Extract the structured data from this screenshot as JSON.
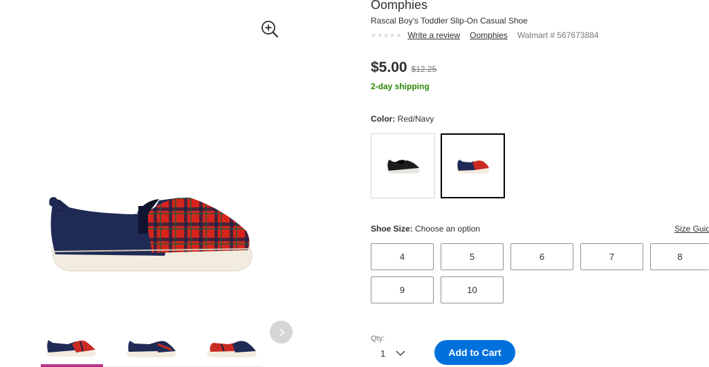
{
  "product": {
    "brand": "Oomphies",
    "name": "Rascal Boy's Toddler Slip-On Casual Shoe",
    "stars": "★★★★★",
    "write_review": "Write a review",
    "brand_link": "Oomphies",
    "walmart_number": "Walmart # 567673884"
  },
  "pricing": {
    "price": "$5.00",
    "was_price": "$12.25",
    "shipping": "2-day shipping"
  },
  "color": {
    "label": "Color:",
    "value": "Red/Navy",
    "options": [
      "Black",
      "Red/Navy"
    ],
    "selected_index": 1
  },
  "size": {
    "label": "Shoe Size:",
    "placeholder": "Choose an option",
    "guide": "Size Guid",
    "options": [
      "4",
      "5",
      "6",
      "7",
      "8",
      "9",
      "10"
    ]
  },
  "purchase": {
    "qty_label": "Qty:",
    "qty_value": "1",
    "add_to_cart": "Add to Cart"
  },
  "gallery": {
    "thumbnail_count": 3,
    "active_thumbnail": 0
  },
  "colors": {
    "accent_blue": "#0071dc",
    "shipping_green": "#2a8703",
    "active_thumb_bar": "#b5338a"
  },
  "icons": {
    "zoom": "zoom-in-icon",
    "next": "chevron-right-icon",
    "qty": "chevron-down-icon"
  }
}
